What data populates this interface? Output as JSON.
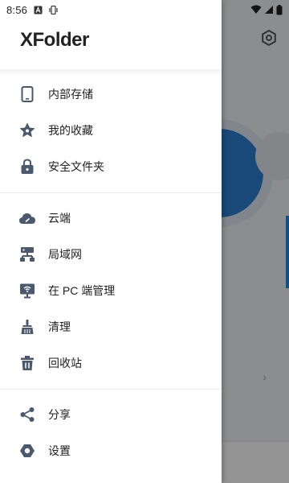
{
  "status": {
    "time": "8:56"
  },
  "app": {
    "title": "XFolder"
  },
  "colors": {
    "icon": "#4a5a6c",
    "background_accent": "#2b7fd0"
  },
  "menu": {
    "storage": [
      {
        "label": "内部存储",
        "icon": "phone-icon"
      },
      {
        "label": "我的收藏",
        "icon": "star-icon"
      },
      {
        "label": "安全文件夹",
        "icon": "lock-icon"
      }
    ],
    "network": [
      {
        "label": "云端",
        "icon": "cloud-icon"
      },
      {
        "label": "局域网",
        "icon": "lan-icon"
      },
      {
        "label": "在 PC 端管理",
        "icon": "pc-wifi-icon"
      },
      {
        "label": "清理",
        "icon": "broom-icon"
      },
      {
        "label": "回收站",
        "icon": "trash-icon"
      }
    ],
    "other": [
      {
        "label": "分享",
        "icon": "share-icon"
      },
      {
        "label": "设置",
        "icon": "settings-icon"
      }
    ]
  }
}
